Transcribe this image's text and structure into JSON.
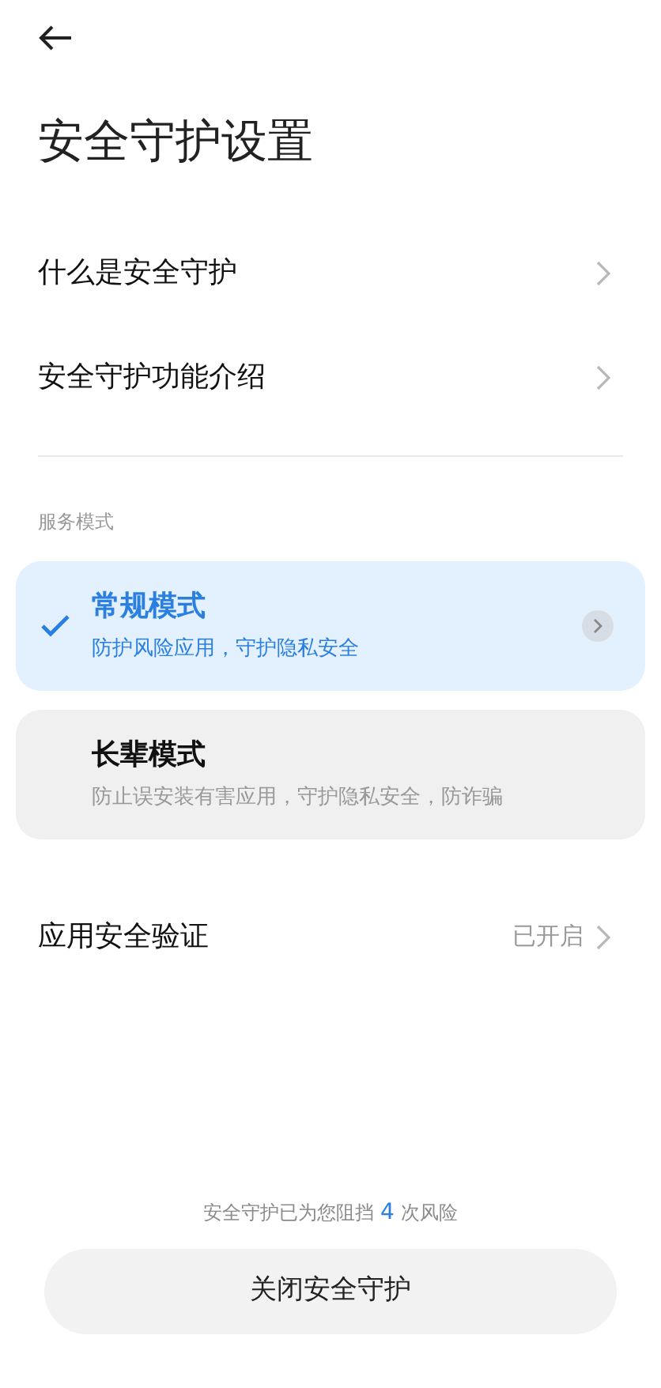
{
  "title": "安全守护设置",
  "menu_items": [
    {
      "label": "什么是安全守护"
    },
    {
      "label": "安全守护功能介绍"
    }
  ],
  "section_label": "服务模式",
  "modes": [
    {
      "title": "常规模式",
      "description": "防护风险应用，守护隐私安全",
      "selected": true
    },
    {
      "title": "长辈模式",
      "description": "防止误安装有害应用，守护隐私安全，防诈骗",
      "selected": false
    }
  ],
  "verify_row": {
    "label": "应用安全验证",
    "value": "已开启"
  },
  "footer": {
    "prefix": "安全守护已为您阻挡",
    "count": "4",
    "suffix": "次风险"
  },
  "close_button": "关闭安全守护"
}
